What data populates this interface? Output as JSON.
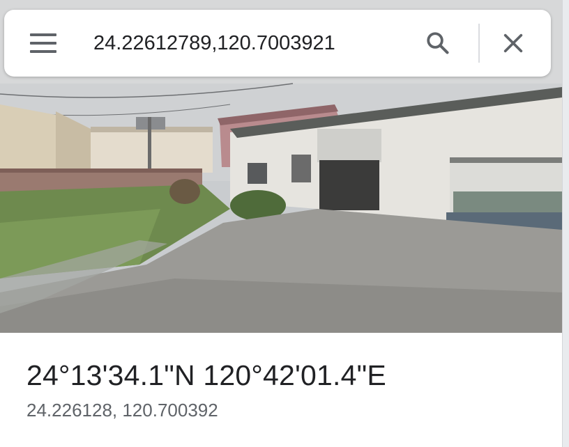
{
  "search": {
    "value": "24.22612789,120.7003921",
    "menu_icon": "hamburger-menu-icon",
    "search_icon": "search-icon",
    "close_icon": "close-icon"
  },
  "place": {
    "dms_coordinates": "24°13'34.1\"N 120°42'01.4\"E",
    "decimal_coordinates": "24.226128, 120.700392"
  },
  "colors": {
    "icon_gray": "#5f6368",
    "text_primary": "#202124",
    "text_secondary": "#5f6368"
  }
}
